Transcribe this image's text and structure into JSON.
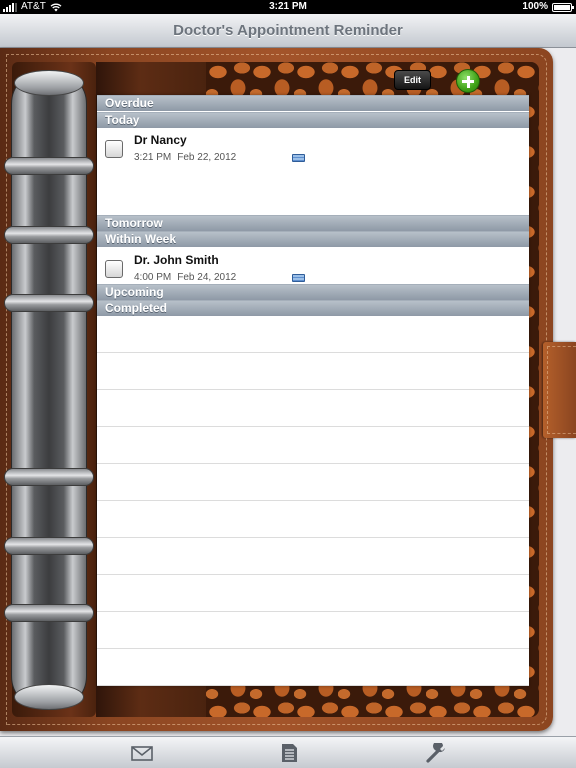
{
  "status_bar": {
    "carrier": "AT&T",
    "time": "3:21 PM",
    "battery": "100%",
    "wifi_icon": "wifi-icon",
    "battery_level": 1.0
  },
  "nav": {
    "title": "Doctor's Appointment Reminder"
  },
  "toolbar": {
    "edit_label": "Edit",
    "add_icon": "plus-circle-icon"
  },
  "sections": {
    "overdue": "Overdue",
    "today": "Today",
    "tomorrow": "Tomorrow",
    "within_week": "Within Week",
    "upcoming": "Upcoming",
    "completed": "Completed"
  },
  "appointments": [
    {
      "name": "Dr Nancy",
      "time": "3:21 PM",
      "date": "Feb 22, 2012",
      "checked": false,
      "note_icon": "note-icon"
    },
    {
      "name": "Dr. John Smith",
      "time": "4:00 PM",
      "date": "Feb 24, 2012",
      "checked": false,
      "note_icon": "note-icon"
    }
  ],
  "tab_bar": {
    "items": [
      "envelope-icon",
      "document-icon",
      "wrench-icon"
    ]
  },
  "colors": {
    "section_header": "#9aa5b1",
    "leather": "#8a4521",
    "add_button": "#3fa116"
  }
}
